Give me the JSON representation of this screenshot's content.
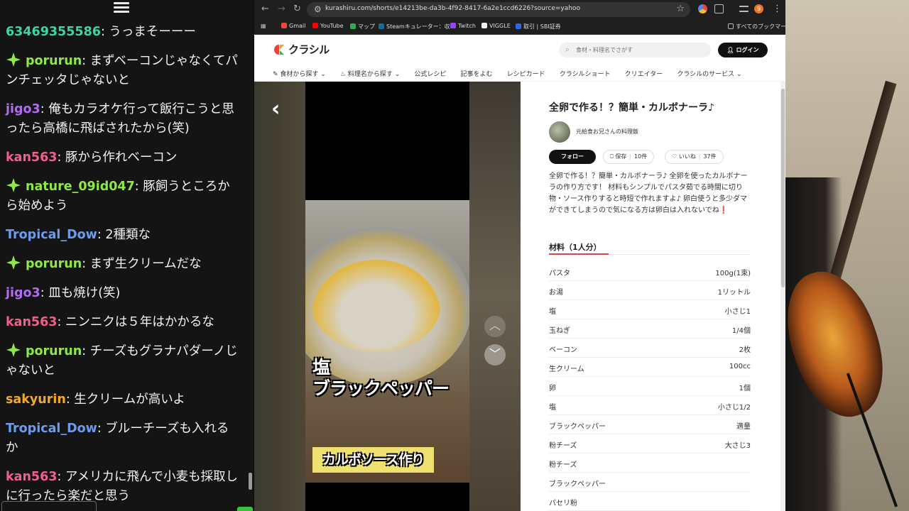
{
  "chat": {
    "messages": [
      {
        "user": "63469355586",
        "color": "#3dd6a0",
        "badge": false,
        "text": "うっまそーーー"
      },
      {
        "user": "porurun",
        "color": "#8ee846",
        "badge": true,
        "text": "まずベーコンじゃなくてパンチェッタじゃないと"
      },
      {
        "user": "jigo3",
        "color": "#b06cf0",
        "badge": false,
        "text": "俺もカラオケ行って飯行こうと思ったら高橋に飛ばされたから(笑)"
      },
      {
        "user": "kan563",
        "color": "#f0608a",
        "badge": false,
        "text": "豚から作れベーコン"
      },
      {
        "user": "nature_09id047",
        "color": "#8ee846",
        "badge": true,
        "text": "豚飼うところから始めよう"
      },
      {
        "user": "Tropical_Dow",
        "color": "#6c9cf0",
        "badge": false,
        "text": "2種類な"
      },
      {
        "user": "porurun",
        "color": "#8ee846",
        "badge": true,
        "text": "まず生クリームだな"
      },
      {
        "user": "jigo3",
        "color": "#b06cf0",
        "badge": false,
        "text": "皿も焼け(笑)"
      },
      {
        "user": "kan563",
        "color": "#f0608a",
        "badge": false,
        "text": "ニンニクは５年はかかるな"
      },
      {
        "user": "porurun",
        "color": "#8ee846",
        "badge": true,
        "text": "チーズもグラナパダーノじゃないと"
      },
      {
        "user": "sakyurin",
        "color": "#f0a830",
        "badge": false,
        "text": "生クリームが高いよ"
      },
      {
        "user": "Tropical_Dow",
        "color": "#6c9cf0",
        "badge": false,
        "text": "ブルーチーズも入れるか"
      },
      {
        "user": "kan563",
        "color": "#f0608a",
        "badge": false,
        "text": "アメリカに飛んで小麦も採取しに行ったら楽だと思う"
      }
    ]
  },
  "browser": {
    "url": "kurashiru.com/shorts/e14213be-da3b-4f92-8417-6a2e1ccd6226?source=yahoo",
    "profile_initial": "9",
    "bookmarks": [
      "Gmail",
      "YouTube",
      "マップ",
      "Steamキュレーター：収...",
      "Twitch",
      "VIGGLE",
      "取引 | SBI証券"
    ],
    "bookmarks_folder": "すべてのブックマーク"
  },
  "site": {
    "logo": "クラシル",
    "search_placeholder": "食材・料理名でさがす",
    "login": "ログイン",
    "nav": [
      "食材から探す",
      "料理名から探す",
      "公式レシピ",
      "記事をよむ",
      "レシピカード",
      "クラシルショート",
      "クリエイター",
      "クラシルのサービス"
    ]
  },
  "video": {
    "caption_main": "塩\nブラックペッパー",
    "caption_sub": "カルボソース作り"
  },
  "recipe": {
    "title": "全卵で作る！？簡単・カルボナーラ♪",
    "author": "元給食お兄さんの料理飯",
    "follow": "フォロー",
    "save_label": "保存",
    "save_count": "10件",
    "like_label": "いいね",
    "like_count": "37件",
    "description": "全卵で作る！？簡単・カルボナーラ♪ 全卵を使ったカルボナーラの作り方です！ 材料もシンプルでパスタ茹でる時間に切り物・ソース作りすると時短で作れますよ♪ 卵白使うと多少ダマができてしまうので気になる方は卵白は入れないでね❗",
    "ingredients_title": "材料（1人分）",
    "ingredients": [
      {
        "name": "パスタ",
        "qty": "100g(1束)"
      },
      {
        "name": "お湯",
        "qty": "1リットル"
      },
      {
        "name": "塩",
        "qty": "小さじ1"
      },
      {
        "name": "玉ねぎ",
        "qty": "1/4個"
      },
      {
        "name": "ベーコン",
        "qty": "2枚"
      },
      {
        "name": "生クリーム",
        "qty": "100cc"
      },
      {
        "name": "卵",
        "qty": "1個"
      },
      {
        "name": "塩",
        "qty": "小さじ1/2"
      },
      {
        "name": "ブラックペッパー",
        "qty": "適量"
      },
      {
        "name": "粉チーズ",
        "qty": "大さじ3"
      },
      {
        "name": "粉チーズ",
        "qty": ""
      },
      {
        "name": "ブラックペッパー",
        "qty": ""
      },
      {
        "name": "パセリ粉",
        "qty": ""
      }
    ]
  }
}
